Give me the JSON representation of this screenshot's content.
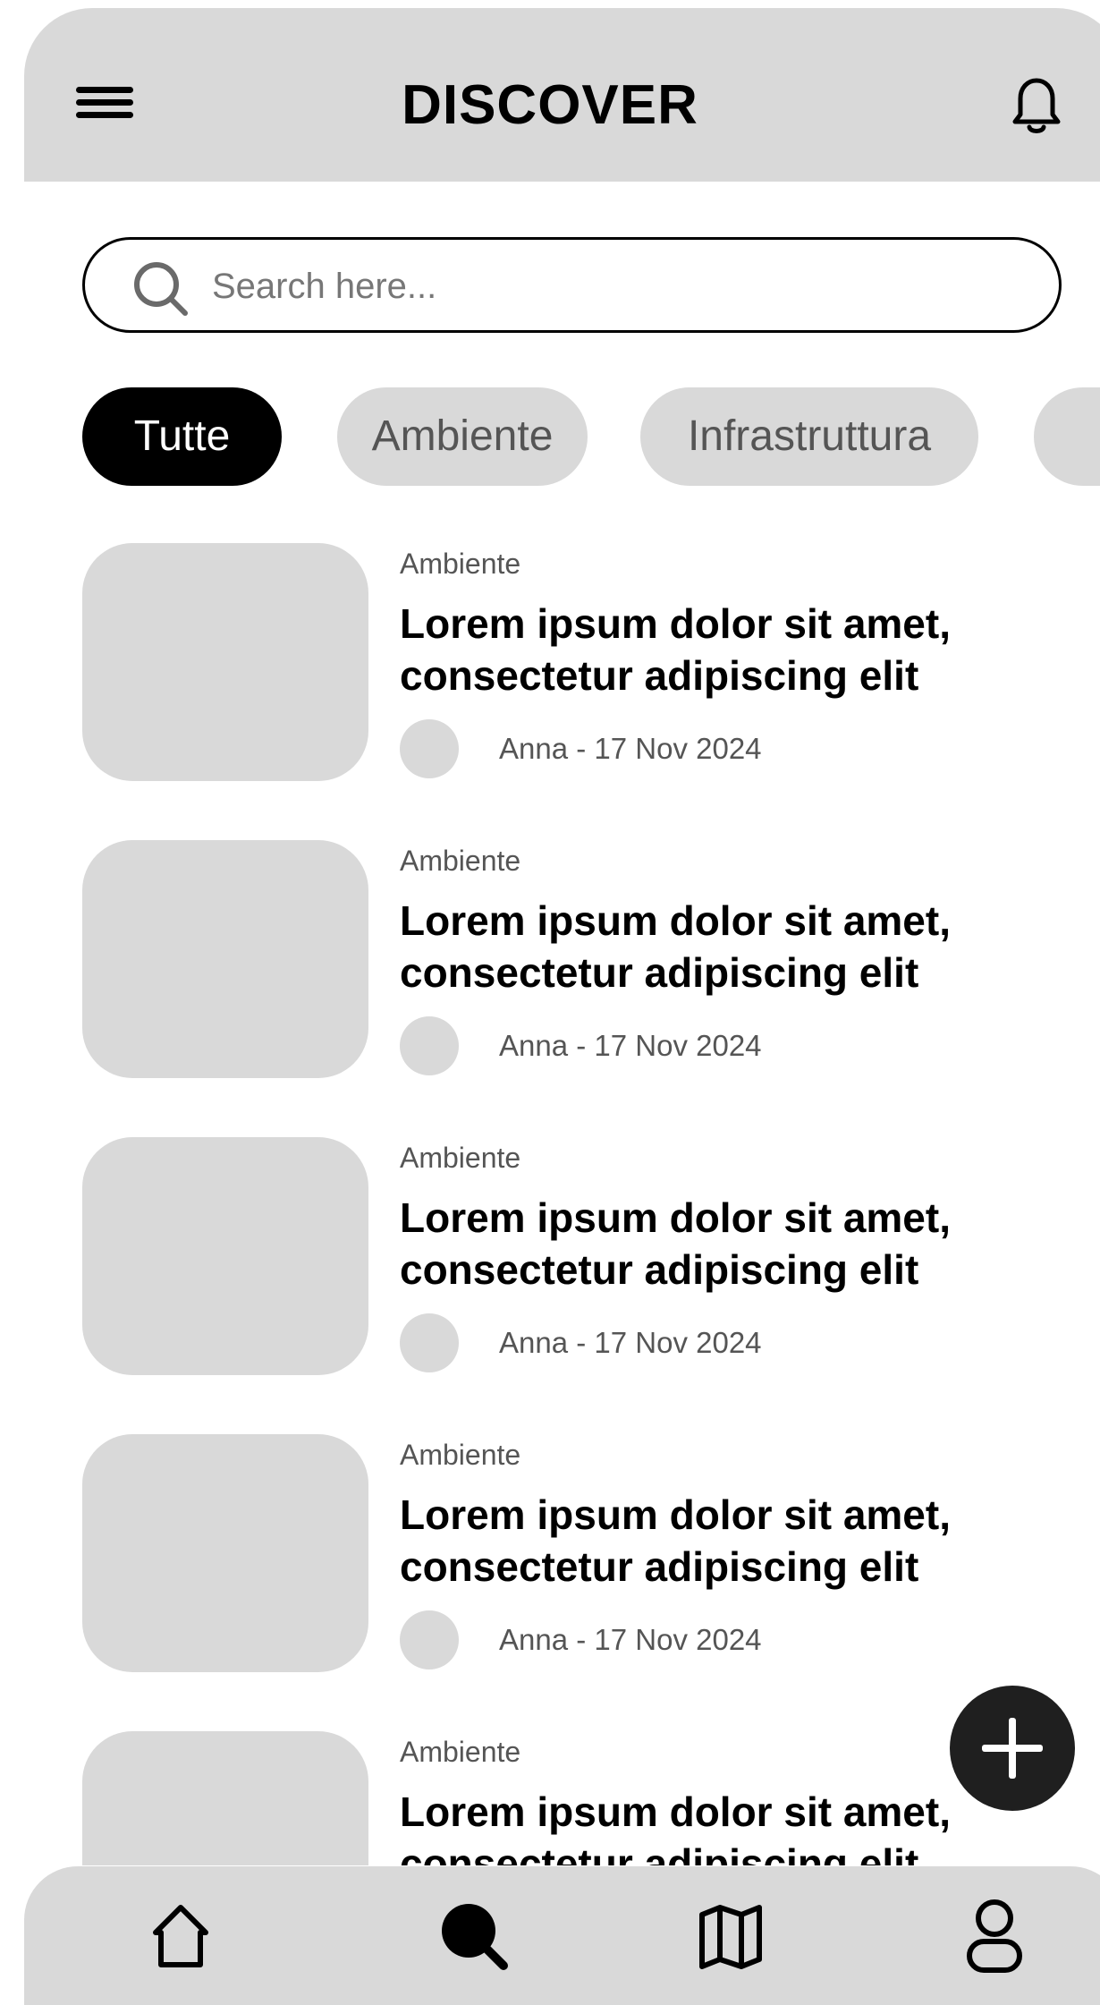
{
  "header": {
    "title": "DISCOVER",
    "menu_icon": "hamburger-menu-icon",
    "notification_icon": "bell-icon"
  },
  "search": {
    "placeholder": "Search here...",
    "icon": "search-icon"
  },
  "filters": {
    "chips": [
      {
        "label": "Tutte",
        "active": true
      },
      {
        "label": "Ambiente",
        "active": false
      },
      {
        "label": "Infrastruttura",
        "active": false
      },
      {
        "label": "",
        "active": false
      }
    ]
  },
  "articles": [
    {
      "category": "Ambiente",
      "title": "Lorem ipsum dolor sit amet, consectetur adipiscing elit",
      "meta": "Anna - 17 Nov 2024"
    },
    {
      "category": "Ambiente",
      "title": "Lorem ipsum dolor sit amet, consectetur adipiscing elit",
      "meta": "Anna - 17 Nov 2024"
    },
    {
      "category": "Ambiente",
      "title": "Lorem ipsum dolor sit amet, consectetur adipiscing elit",
      "meta": "Anna - 17 Nov 2024"
    },
    {
      "category": "Ambiente",
      "title": "Lorem ipsum dolor sit amet, consectetur adipiscing elit",
      "meta": "Anna - 17 Nov 2024"
    },
    {
      "category": "Ambiente",
      "title": "Lorem ipsum dolor sit amet, consectetur adipiscing elit",
      "meta": ""
    }
  ],
  "fab": {
    "icon": "plus-icon"
  },
  "bottom_nav": {
    "items": [
      {
        "name": "home",
        "icon": "home-icon"
      },
      {
        "name": "search",
        "icon": "search-icon"
      },
      {
        "name": "map",
        "icon": "map-icon"
      },
      {
        "name": "profile",
        "icon": "user-icon"
      }
    ]
  },
  "colors": {
    "surface": "#d9d9d9",
    "active_chip": "#000000",
    "fab": "#1f1f1f",
    "text_secondary": "#555555"
  }
}
